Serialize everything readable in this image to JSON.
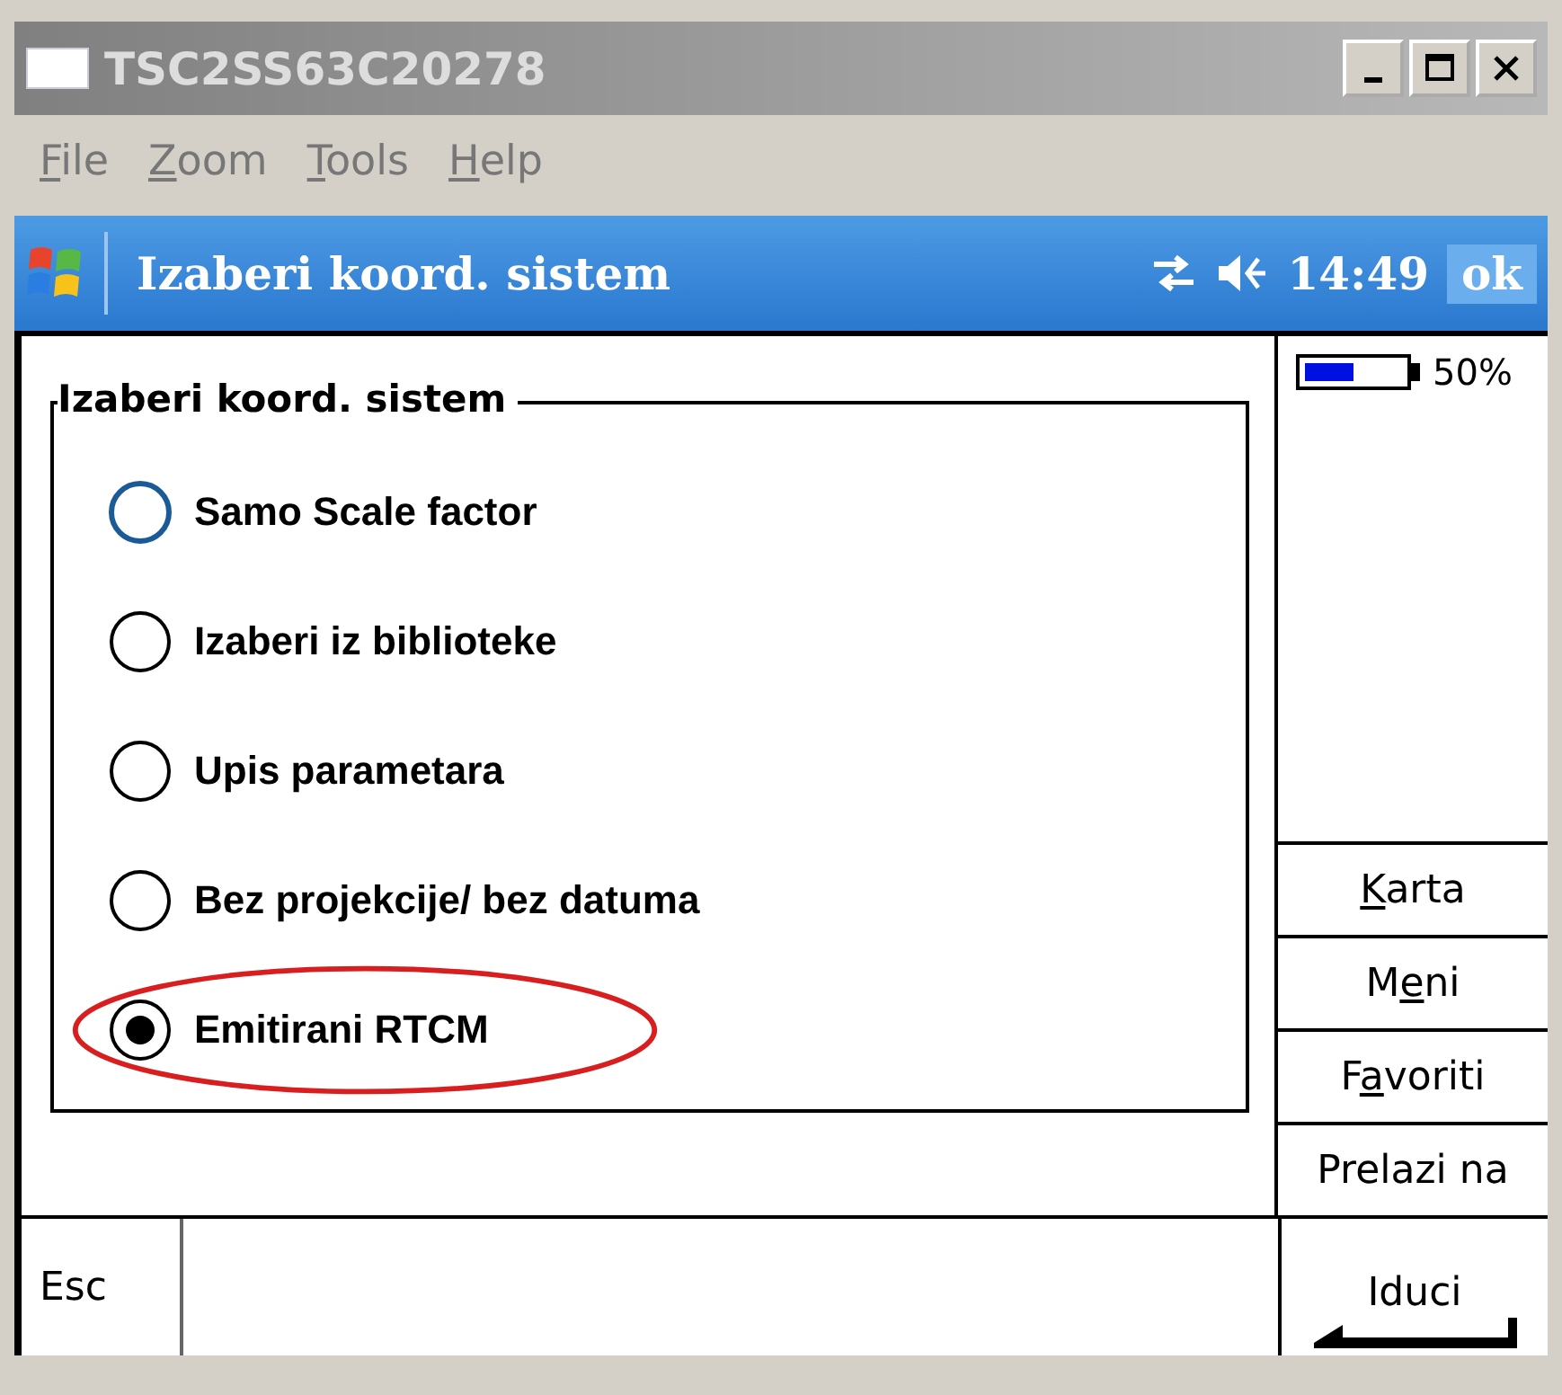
{
  "window": {
    "title": "TSC2SS63C20278"
  },
  "menu": [
    {
      "label": {
        "access_key": "F",
        "after": "ile"
      }
    },
    {
      "label": {
        "access_key": "Z",
        "after": "oom"
      }
    },
    {
      "label": {
        "access_key": "T",
        "after": "ools"
      }
    },
    {
      "label": {
        "access_key": "H",
        "after": "elp"
      }
    }
  ],
  "navbar": {
    "title": "Izaberi koord. sistem",
    "time": "14:49",
    "ok": "ok"
  },
  "group": {
    "legend": "Izaberi koord. sistem",
    "options": [
      {
        "label": "Samo Scale factor",
        "selected": false,
        "focused": true,
        "circled": false
      },
      {
        "label": "Izaberi iz biblioteke",
        "selected": false,
        "focused": false,
        "circled": false
      },
      {
        "label": "Upis parametara",
        "selected": false,
        "focused": false,
        "circled": false
      },
      {
        "label": "Bez projekcije/ bez datuma",
        "selected": false,
        "focused": false,
        "circled": false
      },
      {
        "label": "Emitirani RTCM",
        "selected": true,
        "focused": false,
        "circled": true
      }
    ]
  },
  "battery": {
    "level": 0.5,
    "reading": "50%"
  },
  "side_buttons": [
    {
      "label": {
        "access_key": "K",
        "after": "arta"
      }
    },
    {
      "label": {
        "before": "M",
        "access_key": "e",
        "after": "ni"
      }
    },
    {
      "label": {
        "before": "F",
        "access_key": "a",
        "after": "voriti"
      }
    },
    {
      "label": {
        "before": "Prelazi na"
      }
    }
  ],
  "bottom": {
    "left": "Esc",
    "right": "Iduci"
  }
}
